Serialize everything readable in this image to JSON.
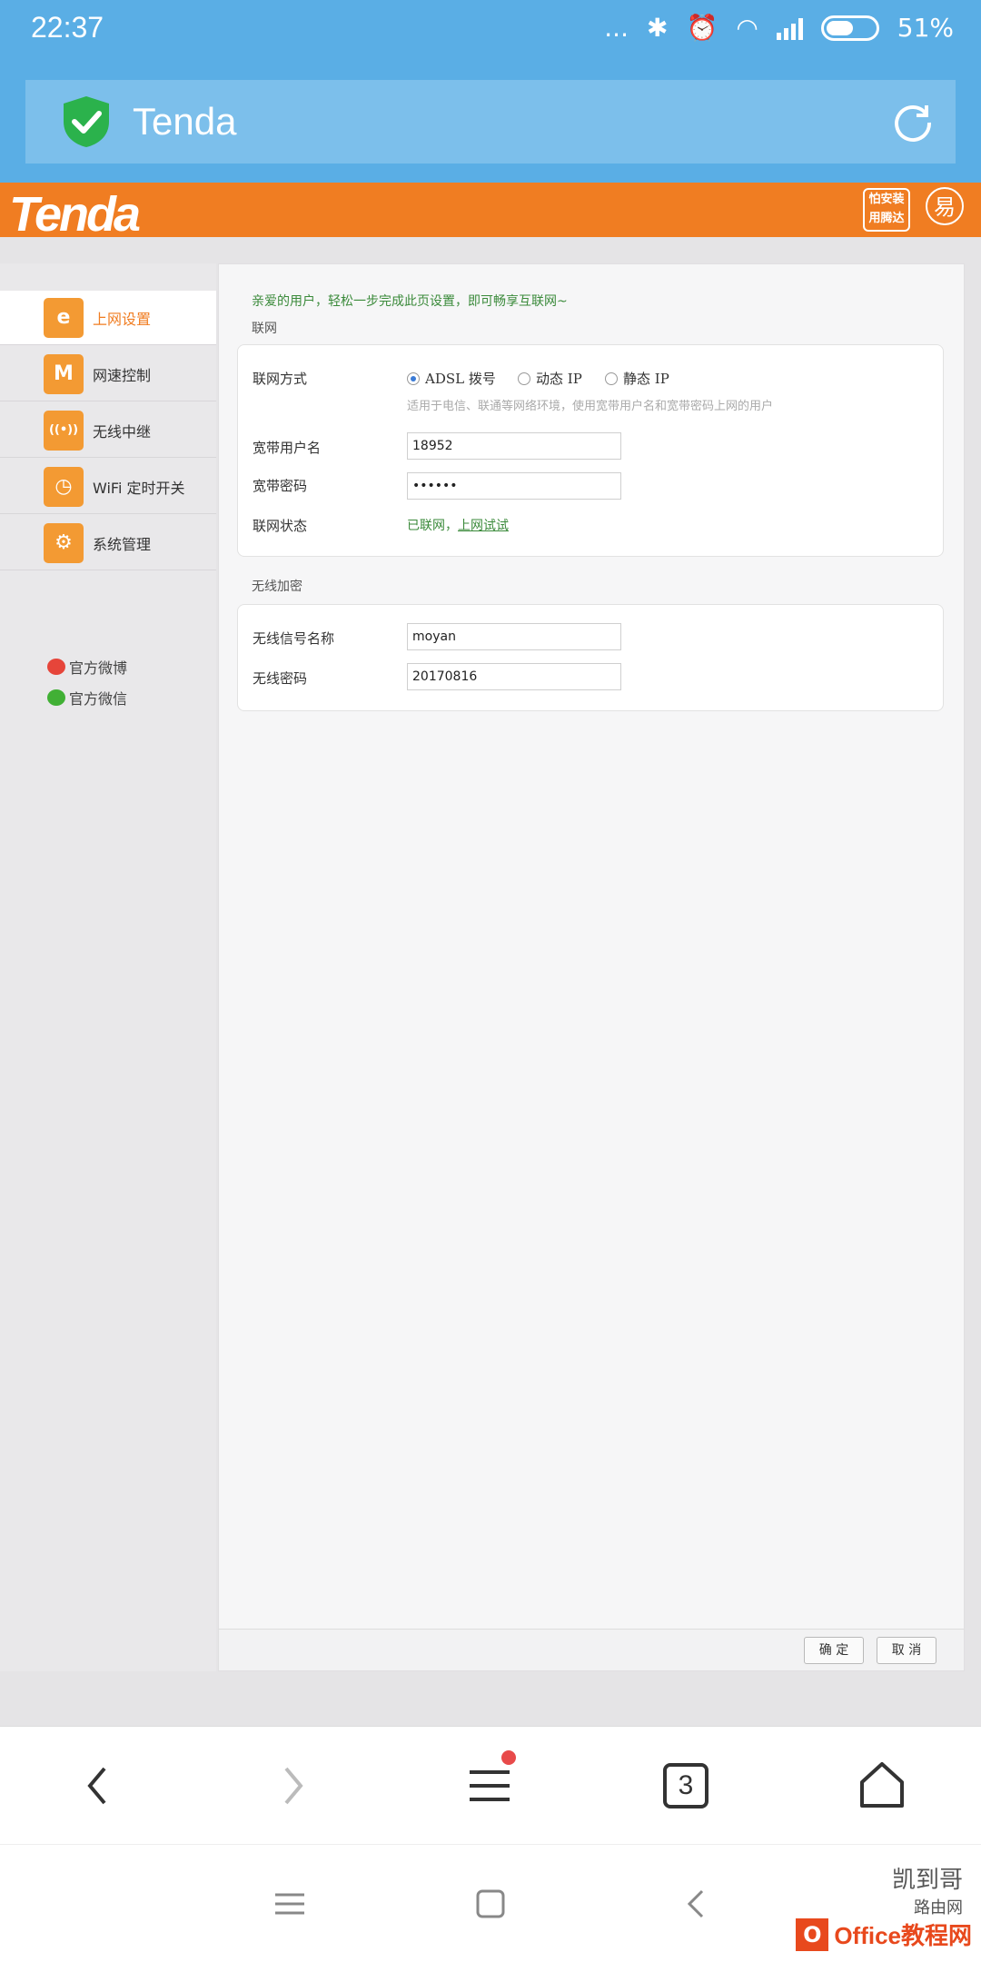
{
  "status_bar": {
    "time": "22:37",
    "dots": "...",
    "battery_percent": "51%",
    "battery_level": 0.51
  },
  "browser": {
    "page_title": "Tenda",
    "tab_count": "3"
  },
  "tenda_header": {
    "logo_text": "Tenda",
    "badge_line1": "怕安装",
    "badge_line2": "用腾达",
    "badge2_text": "易"
  },
  "sidebar": {
    "items": [
      {
        "label": "上网设置",
        "icon": "ie-icon",
        "glyph": "e"
      },
      {
        "label": "网速控制",
        "icon": "speed-icon",
        "glyph": "M"
      },
      {
        "label": "无线中继",
        "icon": "antenna-icon",
        "glyph": "((•))"
      },
      {
        "label": "WiFi 定时开关",
        "icon": "clock-icon",
        "glyph": "◷"
      },
      {
        "label": "系统管理",
        "icon": "gear-icon",
        "glyph": "⚙"
      }
    ],
    "weibo": "官方微博",
    "wechat": "官方微信"
  },
  "main": {
    "welcome": "亲爱的用户，轻松一步完成此页设置，即可畅享互联网~",
    "wan_section": "联网",
    "wan_mode_label": "联网方式",
    "modes": [
      "ADSL 拨号",
      "动态 IP",
      "静态 IP"
    ],
    "mode_hint": "适用于电信、联通等网络环境，使用宽带用户名和宽带密码上网的用户",
    "username_label": "宽带用户名",
    "username_value": "18952",
    "password_label": "宽带密码",
    "password_value": "••••••",
    "status_label": "联网状态",
    "status_text": "已联网，",
    "status_link": "上网试试",
    "wifi_section": "无线加密",
    "ssid_label": "无线信号名称",
    "ssid_value": "moyan",
    "wifi_pwd_label": "无线密码",
    "wifi_pwd_value": "20170816",
    "ok_button": "确 定",
    "cancel_button": "取 消"
  },
  "watermark": {
    "line1": "凯到哥",
    "line2": "路由网",
    "brand": "Office教程网"
  }
}
